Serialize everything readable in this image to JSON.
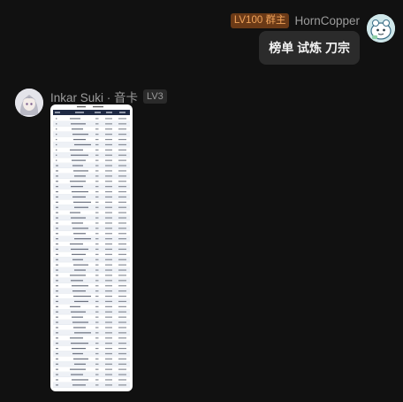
{
  "messages": {
    "right": {
      "role_badge": "LV100 群主",
      "sender": "HornCopper",
      "text": "榜单 试炼 刀宗"
    },
    "left": {
      "sender": "Inkar Suki · 音卡",
      "level_badge": "LV3"
    }
  },
  "icons": {
    "right_avatar": "cartoon-avatar-icon",
    "left_avatar": "anime-girl-avatar-icon"
  }
}
